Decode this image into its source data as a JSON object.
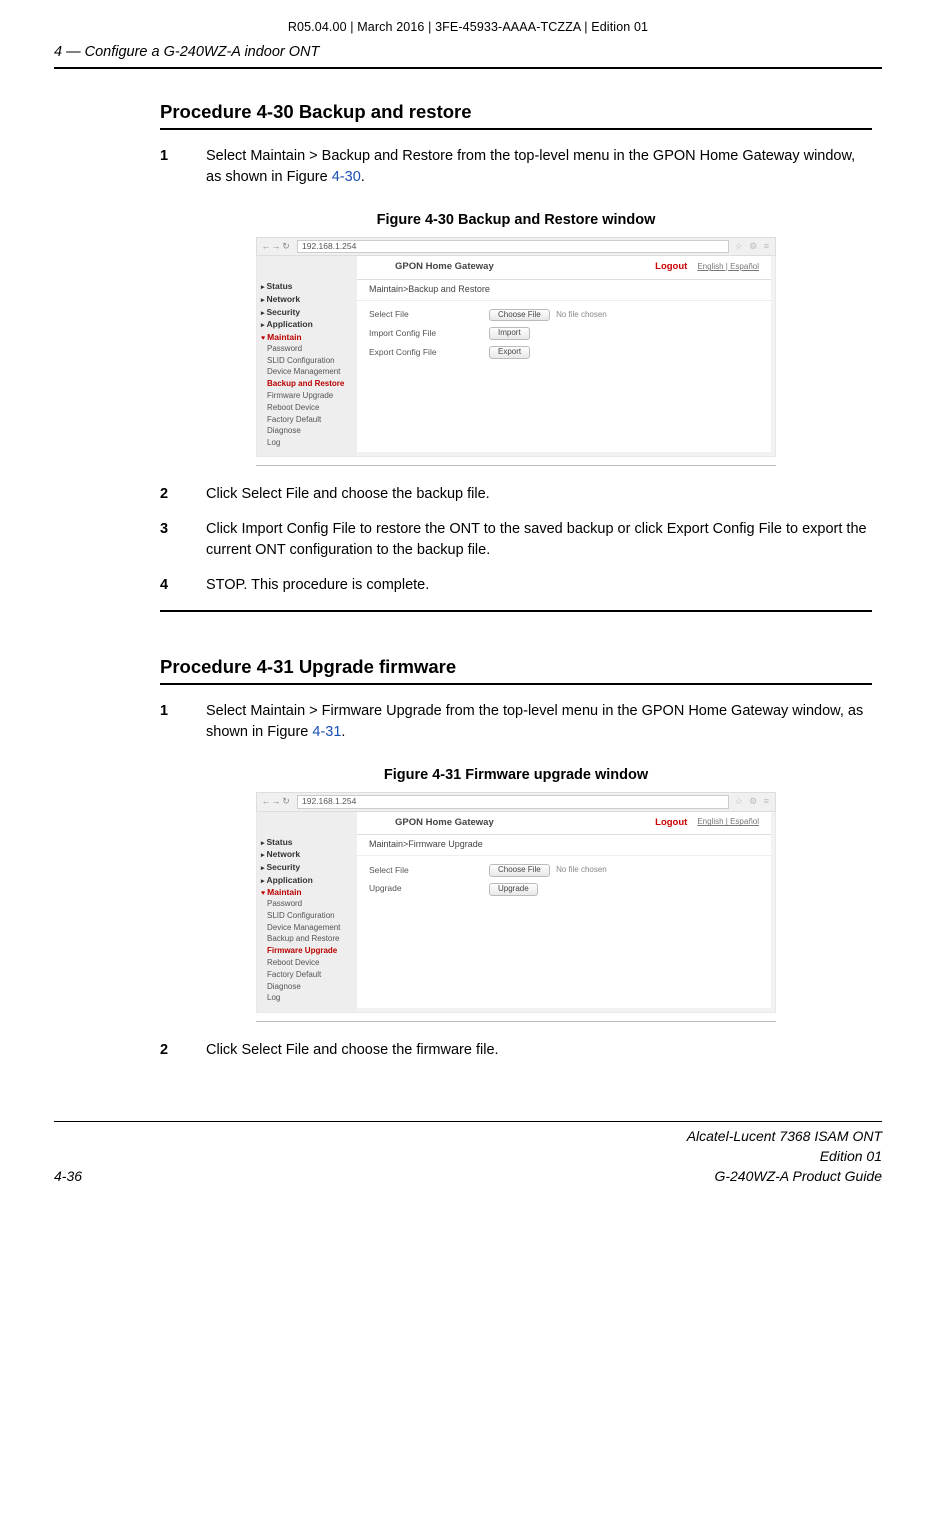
{
  "top_meta": "R05.04.00 | March 2016 | 3FE-45933-AAAA-TCZZA | Edition 01",
  "section_header": "4 —  Configure a G-240WZ-A indoor ONT",
  "proc430": {
    "title": "Procedure 4-30  Backup and restore",
    "step1": "Select Maintain > Backup and Restore from the top-level menu in the GPON Home Gateway window, as shown in Figure ",
    "step1_ref": "4-30",
    "step1_tail": ".",
    "fig_caption": "Figure 4-30  Backup and Restore window",
    "step2": "Click Select File and choose the backup file.",
    "step3": "Click Import Config File to restore the ONT to the saved backup or click Export Config File to export the current ONT configuration to the backup file.",
    "step4": "STOP. This procedure is complete."
  },
  "proc431": {
    "title": "Procedure 4-31  Upgrade firmware",
    "step1": "Select Maintain > Firmware Upgrade from the top-level menu in the GPON Home Gateway window, as shown in Figure ",
    "step1_ref": "4-31",
    "step1_tail": ".",
    "fig_caption": "Figure 4-31  Firmware upgrade window",
    "step2": "Click Select File and choose the firmware file."
  },
  "figure_common": {
    "url": "192.168.1.254",
    "gateway_title": "GPON Home Gateway",
    "logout": "Logout",
    "lang": "English | Español",
    "sidebar_top": [
      "Status",
      "Network",
      "Security",
      "Application"
    ],
    "sidebar_maintain": "Maintain",
    "sidebar_sub430": [
      "Password",
      "SLID Configuration",
      "Device Management",
      "Backup and Restore",
      "Firmware Upgrade",
      "Reboot Device",
      "Factory Default",
      "Diagnose",
      "Log"
    ],
    "sidebar_sub431": [
      "Password",
      "SLID Configuration",
      "Device Management",
      "Backup and Restore",
      "Firmware Upgrade",
      "Reboot Device",
      "Factory Default",
      "Diagnose",
      "Log"
    ],
    "breadcrumb430": "Maintain>Backup and Restore",
    "breadcrumb431": "Maintain>Firmware Upgrade",
    "rows430": {
      "select_file": "Select File",
      "choose_file": "Choose File",
      "no_file": "No file chosen",
      "import_label": "Import Config File",
      "import_btn": "Import",
      "export_label": "Export Config File",
      "export_btn": "Export"
    },
    "rows431": {
      "select_file": "Select File",
      "choose_file": "Choose File",
      "no_file": "No file chosen",
      "upgrade_label": "Upgrade",
      "upgrade_btn": "Upgrade"
    }
  },
  "footer": {
    "pageno": "4-36",
    "line1": "Alcatel-Lucent 7368 ISAM ONT",
    "line2": "Edition 01",
    "line3": "G-240WZ-A Product Guide"
  }
}
